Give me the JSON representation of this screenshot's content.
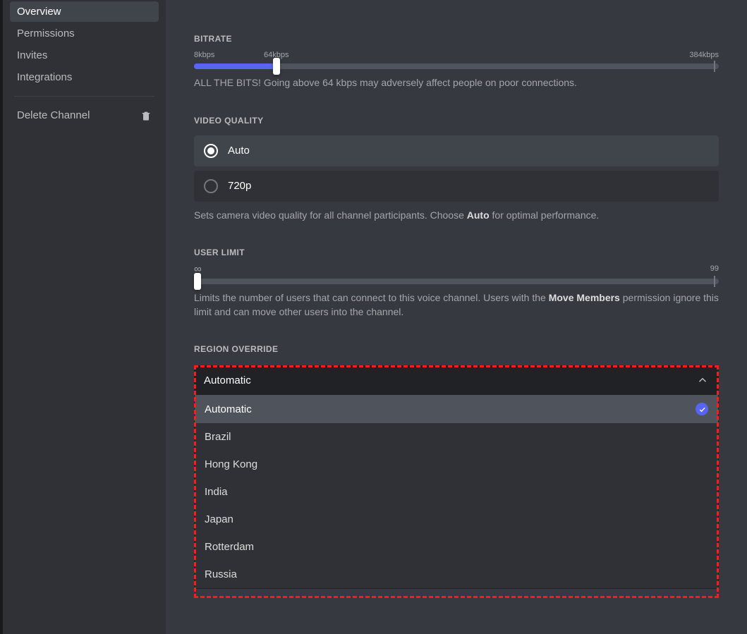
{
  "sidebar": {
    "items": [
      {
        "label": "Overview",
        "active": true
      },
      {
        "label": "Permissions",
        "active": false
      },
      {
        "label": "Invites",
        "active": false
      },
      {
        "label": "Integrations",
        "active": false
      }
    ],
    "delete_label": "Delete Channel"
  },
  "bitrate": {
    "heading": "BITRATE",
    "min_label": "8kbps",
    "mid_label": "64kbps",
    "max_label": "384kbps",
    "value_kbps": 64,
    "min_kbps": 8,
    "max_kbps": 384,
    "description": "ALL THE BITS! Going above 64 kbps may adversely affect people on poor connections."
  },
  "video_quality": {
    "heading": "VIDEO QUALITY",
    "options": [
      {
        "label": "Auto",
        "selected": true
      },
      {
        "label": "720p",
        "selected": false
      }
    ],
    "description_pre": "Sets camera video quality for all channel participants. Choose ",
    "description_bold": "Auto",
    "description_post": " for optimal performance."
  },
  "user_limit": {
    "heading": "USER LIMIT",
    "inf_symbol": "∞",
    "max_label": "99",
    "value": 0,
    "description_pre": "Limits the number of users that can connect to this voice channel. Users with the ",
    "description_bold": "Move Members",
    "description_post": " permission ignore this limit and can move other users into the channel."
  },
  "region": {
    "heading": "REGION OVERRIDE",
    "selected_label": "Automatic",
    "options": [
      {
        "label": "Automatic",
        "selected": true
      },
      {
        "label": "Brazil",
        "selected": false
      },
      {
        "label": "Hong Kong",
        "selected": false
      },
      {
        "label": "India",
        "selected": false
      },
      {
        "label": "Japan",
        "selected": false
      },
      {
        "label": "Rotterdam",
        "selected": false
      },
      {
        "label": "Russia",
        "selected": false
      }
    ]
  }
}
